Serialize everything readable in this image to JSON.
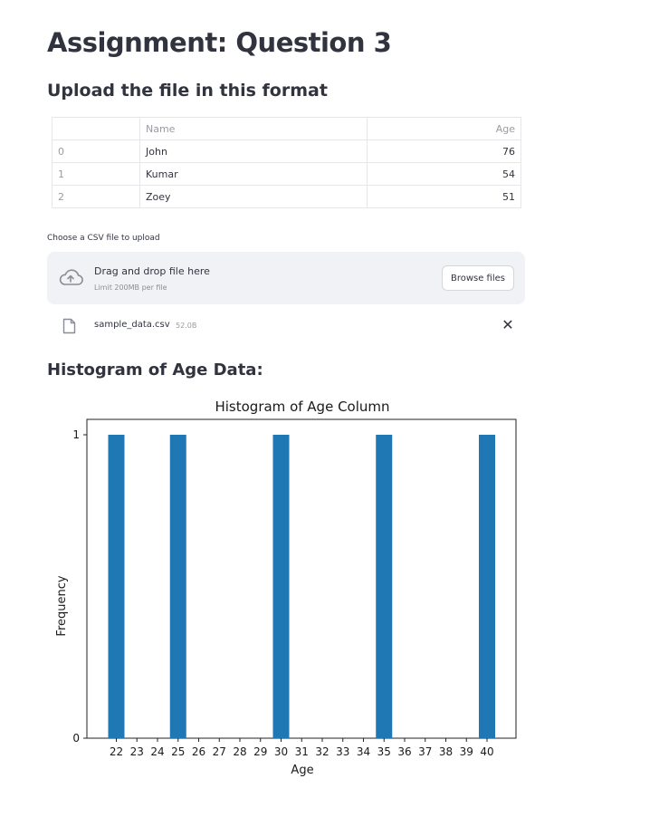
{
  "page": {
    "title": "Assignment: Question 3",
    "subtitle": "Upload the file in this format"
  },
  "sample_table": {
    "columns": [
      "",
      "Name",
      "Age"
    ],
    "rows": [
      {
        "index": "0",
        "name": "John",
        "age": "76"
      },
      {
        "index": "1",
        "name": "Kumar",
        "age": "54"
      },
      {
        "index": "2",
        "name": "Zoey",
        "age": "51"
      }
    ]
  },
  "uploader": {
    "label": "Choose a CSV file to upload",
    "drop_text": "Drag and drop file here",
    "limit_text": "Limit 200MB per file",
    "browse_label": "Browse files",
    "file_name": "sample_data.csv",
    "file_size": "52.0B",
    "remove_label": "✕"
  },
  "histogram_heading": "Histogram of Age Data:",
  "colors": {
    "bar": "#1f77b4",
    "text": "#31333f",
    "dropzone_bg": "#f0f2f6"
  },
  "chart_data": {
    "type": "bar",
    "title": "Histogram of Age Column",
    "xlabel": "Age",
    "ylabel": "Frequency",
    "categories": [
      "22",
      "23",
      "24",
      "25",
      "26",
      "27",
      "28",
      "29",
      "30",
      "31",
      "32",
      "33",
      "34",
      "35",
      "36",
      "37",
      "38",
      "39",
      "40"
    ],
    "values": [
      1,
      0,
      0,
      1,
      0,
      0,
      0,
      0,
      1,
      0,
      0,
      0,
      0,
      1,
      0,
      0,
      0,
      0,
      1
    ],
    "y_ticks": [
      "0",
      "1"
    ],
    "ylim": [
      0,
      1
    ],
    "grid": false,
    "legend": "none"
  }
}
